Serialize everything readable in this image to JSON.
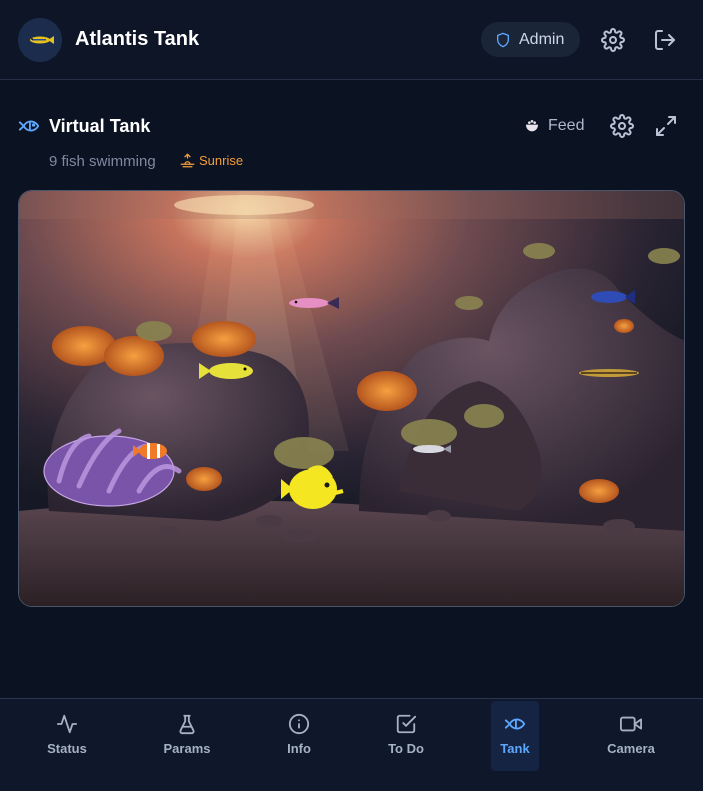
{
  "header": {
    "app_title": "Atlantis Tank",
    "admin_label": "Admin"
  },
  "panel": {
    "title": "Virtual Tank",
    "feed_label": "Feed",
    "fish_count_text": "9 fish swimming",
    "phase_label": "Sunrise"
  },
  "nav": {
    "items": [
      {
        "label": "Status",
        "icon": "activity-icon"
      },
      {
        "label": "Params",
        "icon": "flask-icon"
      },
      {
        "label": "Info",
        "icon": "info-icon"
      },
      {
        "label": "To Do",
        "icon": "checkbox-icon"
      },
      {
        "label": "Tank",
        "icon": "fish-icon",
        "active": true
      },
      {
        "label": "Camera",
        "icon": "video-icon"
      }
    ]
  },
  "colors": {
    "accent": "#5ea7ff",
    "sunrise": "#f59e3a",
    "background": "#0b1222"
  }
}
